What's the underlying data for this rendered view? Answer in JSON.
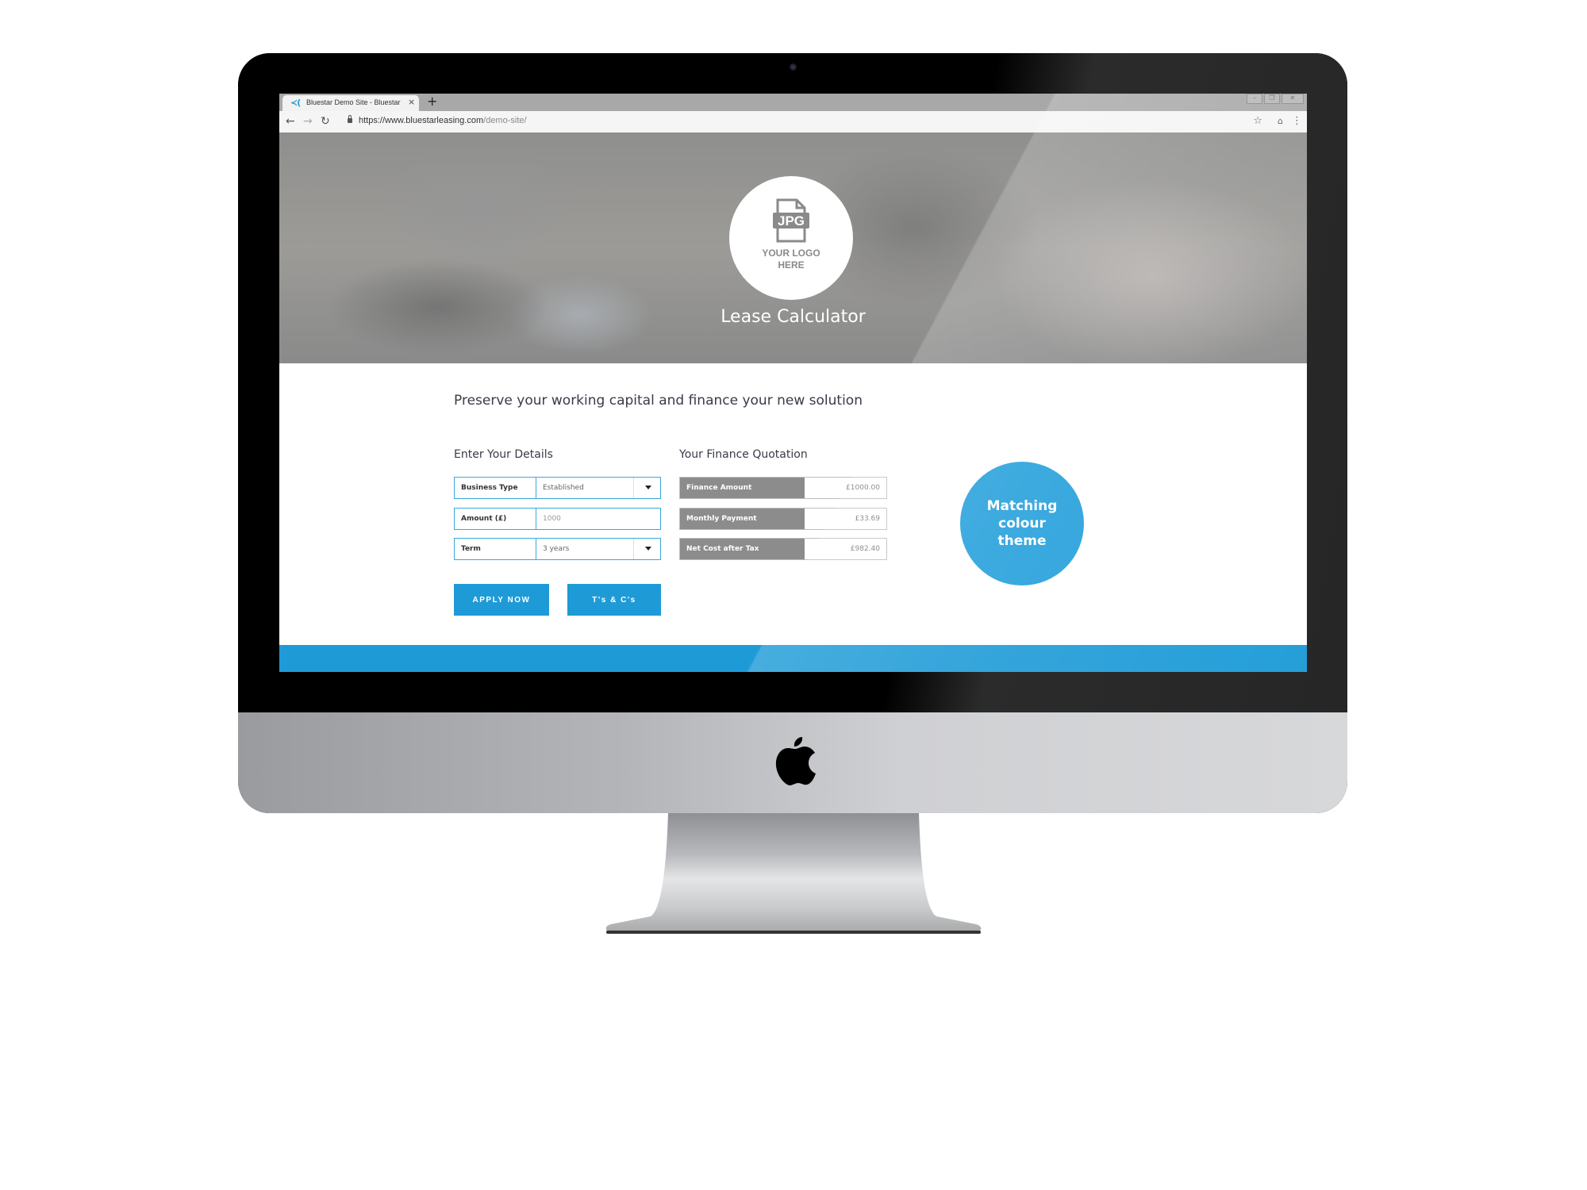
{
  "browser": {
    "tab_title": "Bluestar Demo Site - Bluestar",
    "tab_favicon": "bluestar-logo",
    "new_tab_label": "+",
    "close_tab_label": "×",
    "url_domain": "https://www.bluestarleasing.com",
    "url_path": "/demo-site/",
    "nav": {
      "back": "←",
      "forward": "→",
      "reload": "↻"
    },
    "tools": {
      "bookmark": "☆",
      "incognito": "incognito-icon",
      "menu": "⋮"
    },
    "window_controls": {
      "minimize": "–",
      "restore": "❐",
      "close": "✕"
    }
  },
  "hero": {
    "logo_badge": "JPG",
    "logo_text_line1": "YOUR LOGO",
    "logo_text_line2": "HERE",
    "title": "Lease Calculator"
  },
  "main": {
    "headline": "Preserve your working capital and finance your new solution",
    "details": {
      "title": "Enter Your Details",
      "fields": [
        {
          "label": "Business Type",
          "value": "Established",
          "type": "select"
        },
        {
          "label": "Amount (£)",
          "placeholder": "1000",
          "type": "input"
        },
        {
          "label": "Term",
          "value": "3 years",
          "type": "select"
        }
      ]
    },
    "quotation": {
      "title": "Your Finance Quotation",
      "rows": [
        {
          "label": "Finance Amount",
          "value": "£1000.00"
        },
        {
          "label": "Monthly Payment",
          "value": "£33.69"
        },
        {
          "label": "Net Cost after Tax",
          "value": "£982.40"
        }
      ]
    },
    "buttons": {
      "apply": "APPLY NOW",
      "terms": "T's & C's"
    },
    "badge_text": "Matching colour theme"
  },
  "colors": {
    "accent": "#1e9bd7",
    "quote_label_bg": "#8c8c8c",
    "field_border": "#39a9d9"
  }
}
